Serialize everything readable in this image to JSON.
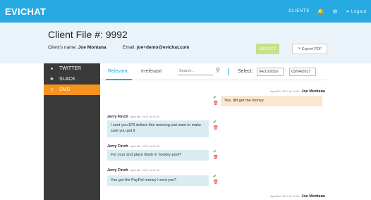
{
  "app": {
    "brand": "EVICHAT",
    "nav": {
      "clients": "CLIENTS",
      "logout": "Logout"
    },
    "icons": {
      "bell": "bell-icon",
      "gear": "gear-icon",
      "logout": "logout-icon"
    },
    "colors": {
      "primary": "#27a9e1",
      "accent": "#f7931e",
      "sidebar": "#3a3a3a",
      "select_button": "#c5e18a"
    }
  },
  "header": {
    "title": "Client File #: 9992",
    "client_label": "Client's name:",
    "client_name": "Joe Montana",
    "email_label": "Email:",
    "email_value": "joe+demo@evichat.com",
    "select_button": "SELECT",
    "export_button": "Export PDF"
  },
  "sidebar": {
    "items": [
      {
        "label": "TWITTER",
        "icon": "twitter-icon",
        "active": false
      },
      {
        "label": "SLACK",
        "icon": "slack-icon",
        "active": false
      },
      {
        "label": "SMS",
        "icon": "sms-icon",
        "active": true
      }
    ]
  },
  "toolbar": {
    "tabs": [
      {
        "label": "Relevant",
        "active": true
      },
      {
        "label": "Irrelevant",
        "active": false
      }
    ],
    "search_placeholder": "Search...",
    "select_label": "Select:",
    "date_from": "04/10/2016",
    "date_to": "03/04/2017",
    "date_separator": "-"
  },
  "messages": [
    {
      "sender": "Joe Montana",
      "time": "April 8th, 2017 at 12:00",
      "text": "Yes, did get the money",
      "direction": "out"
    },
    {
      "sender": "Jerry Finch",
      "time": "April 8th, 2017 at 12:00",
      "text": "I sent you $75 dollars this morning just want to make sure you got it",
      "direction": "in"
    },
    {
      "sender": "Jerry Finch",
      "time": "April 8th, 2017 at 12:00",
      "text": "For your 2nd place finish in hockey pool?",
      "direction": "in"
    },
    {
      "sender": "Jerry Finch",
      "time": "April 8th, 2017 at 12:00",
      "text": "You got the PayPal money I sent you?",
      "direction": "in"
    },
    {
      "sender": "Joe Montana",
      "time": "April 8th, 2017 at 12:00",
      "text": "",
      "direction": "out"
    }
  ],
  "marks": {
    "approve": "✔",
    "delete": "🗑"
  }
}
